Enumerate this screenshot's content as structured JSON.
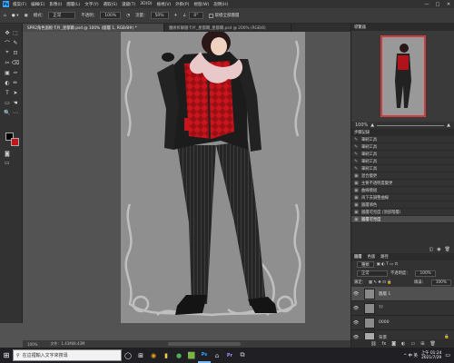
{
  "menubar": {
    "logo": "Ps",
    "items": [
      "檔案(F)",
      "編輯(E)",
      "影像(I)",
      "圖層(L)",
      "文字(Y)",
      "選取(S)",
      "濾鏡(T)",
      "3D(D)",
      "檢視(V)",
      "外掛(P)",
      "視窗(W)",
      "說明(H)"
    ],
    "controls": [
      "—",
      "□",
      "✕"
    ]
  },
  "options": {
    "mode_label": "模式：",
    "mode_value": "正常",
    "opacity_label": "不透明：",
    "opacity_value": "100%",
    "flow_label": "流量：",
    "flow_value": "50%",
    "angle_value": "0°",
    "sample_label": "取樣全部圖層"
  },
  "tabs": [
    {
      "label": "SPR2角色面板卡片_星都爾.psd @ 100% (圖層 1, RGB/8#) *",
      "active": true
    },
    {
      "label": "魔術拆解圖卡片_星都爾_星都爾.psd @ 200% (RGB/8)",
      "active": false
    }
  ],
  "tools": [
    "✥",
    "⬚",
    "⌒",
    "✎",
    "⌖",
    "⊡",
    "✂",
    "⌫",
    "▣",
    "✑",
    "◐",
    "✏",
    "T",
    "➤",
    "▭",
    "☚",
    "🔍",
    "⋯"
  ],
  "status": {
    "zoom": "100%",
    "docsize": "文件：1.43M/8.43M"
  },
  "navigator": {
    "title": "導覽器",
    "zoom": "100%"
  },
  "history": {
    "title": "步驟記錄",
    "items": [
      "筆刷工具",
      "筆刷工具",
      "筆刷工具",
      "筆刷工具",
      "筆刷工具",
      "混合變更",
      "主要不透明度變更",
      "曲線模組",
      "再下去調整曲線",
      "圖層填色",
      "圖層可見度 (頂部階層)",
      "圖層可見度"
    ],
    "selected_index": 11
  },
  "layers": {
    "tabs": [
      "圖層",
      "色版",
      "路徑"
    ],
    "kind_label": "種類",
    "blend_value": "正常",
    "opacity_label": "不透明度：",
    "opacity_value": "100%",
    "lock_label": "鎖定：",
    "fill_label": "填滿：",
    "fill_value": "100%",
    "items": [
      {
        "name": "圖層 1",
        "selected": true
      },
      {
        "name": "??",
        "selected": false
      },
      {
        "name": "0000",
        "selected": false
      },
      {
        "name": "背景",
        "selected": false
      }
    ]
  },
  "taskbar": {
    "search_placeholder": "在這裡輸入文字來搜尋",
    "apps": [
      "◯",
      "⊞",
      "◉",
      "▮",
      "●",
      "🟩",
      "Ps",
      "⌂",
      "Pr",
      "⧉"
    ],
    "active_app_index": 6,
    "time": "上午 01:24",
    "date": "2021/7/29",
    "tray": "^ 中 英"
  },
  "colors": {
    "accent": "#31a8ff",
    "foreground_color": "#000000",
    "background_color": "#c4141c"
  }
}
